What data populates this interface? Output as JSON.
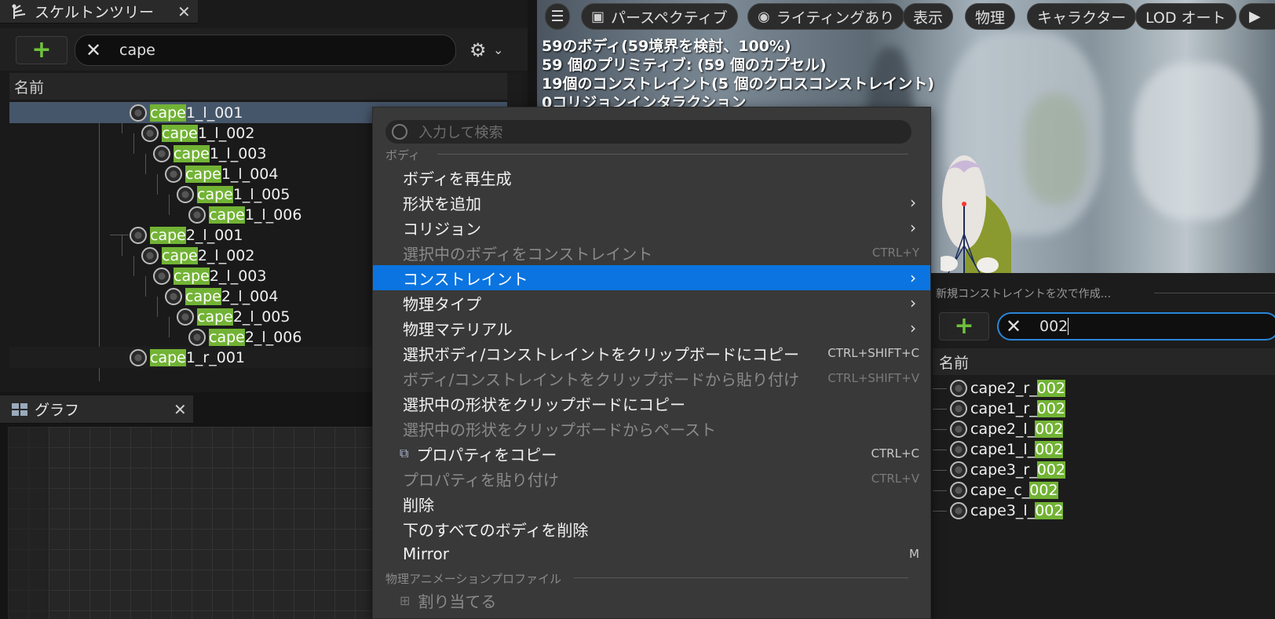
{
  "skeleton_panel": {
    "tab_title": "スケルトンツリー",
    "search_value": "cape",
    "column_header": "名前",
    "rows": [
      {
        "prefix": "cape",
        "rest": "1_l_001",
        "selected": true
      },
      {
        "prefix": "cape",
        "rest": "1_l_002"
      },
      {
        "prefix": "cape",
        "rest": "1_l_003"
      },
      {
        "prefix": "cape",
        "rest": "1_l_004"
      },
      {
        "prefix": "cape",
        "rest": "1_l_005"
      },
      {
        "prefix": "cape",
        "rest": "1_l_006"
      },
      {
        "prefix": "cape",
        "rest": "2_l_001"
      },
      {
        "prefix": "cape",
        "rest": "2_l_002"
      },
      {
        "prefix": "cape",
        "rest": "2_l_003"
      },
      {
        "prefix": "cape",
        "rest": "2_l_004"
      },
      {
        "prefix": "cape",
        "rest": "2_l_005"
      },
      {
        "prefix": "cape",
        "rest": "2_l_006"
      },
      {
        "prefix": "cape",
        "rest": "1_r_001"
      }
    ]
  },
  "graph_panel": {
    "tab_title": "グラフ"
  },
  "viewport": {
    "toolbar": {
      "perspective": "パースペクティブ",
      "lighting": "ライティングあり",
      "show": "表示",
      "physics": "物理",
      "character": "キャラクター",
      "lod": "LOD オート"
    },
    "stats": [
      "59のボディ(59境界を検討、100%)",
      "59 個のプリミティブ: (59 個のカプセル)",
      "19個のコンストレイント(5 個のクロスコンストレイント)",
      "0コリジョンインタラクション"
    ]
  },
  "context_menu": {
    "search_placeholder": "入力して検索",
    "section_body": "ボディ",
    "section_anim": "物理アニメーションプロファイル",
    "items": {
      "regenerate": "ボディを再生成",
      "add_shape": "形状を追加",
      "collision": "コリジョン",
      "constrain_selected": "選択中のボディをコンストレイント",
      "constrain_selected_sc": "CTRL+Y",
      "constraints": "コンストレイント",
      "physics_type": "物理タイプ",
      "physical_material": "物理マテリアル",
      "copy_bodies": "選択ボディ/コンストレイントをクリップボードにコピー",
      "copy_bodies_sc": "CTRL+SHIFT+C",
      "paste_bodies": "ボディ/コンストレイントをクリップボードから貼り付け",
      "paste_bodies_sc": "CTRL+SHIFT+V",
      "copy_shapes": "選択中の形状をクリップボードにコピー",
      "paste_shapes": "選択中の形状をクリップボードからペースト",
      "copy_props": "プロパティをコピー",
      "copy_props_sc": "CTRL+C",
      "paste_props": "プロパティを貼り付け",
      "paste_props_sc": "CTRL+V",
      "delete": "削除",
      "delete_below": "下のすべてのボディを削除",
      "mirror": "Mirror",
      "mirror_sc": "M",
      "assign": "割り当てる"
    }
  },
  "constraint_panel": {
    "header": "新規コンストレイントを次で作成...",
    "search_value": "002",
    "column_header": "名前",
    "rows": [
      {
        "name": "cape2_r_",
        "match": "002"
      },
      {
        "name": "cape1_r_",
        "match": "002"
      },
      {
        "name": "cape2_l_",
        "match": "002"
      },
      {
        "name": "cape1_l_",
        "match": "002"
      },
      {
        "name": "cape3_r_",
        "match": "002"
      },
      {
        "name": "cape_c_",
        "match": "002"
      },
      {
        "name": "cape3_l_",
        "match": "002"
      }
    ]
  }
}
